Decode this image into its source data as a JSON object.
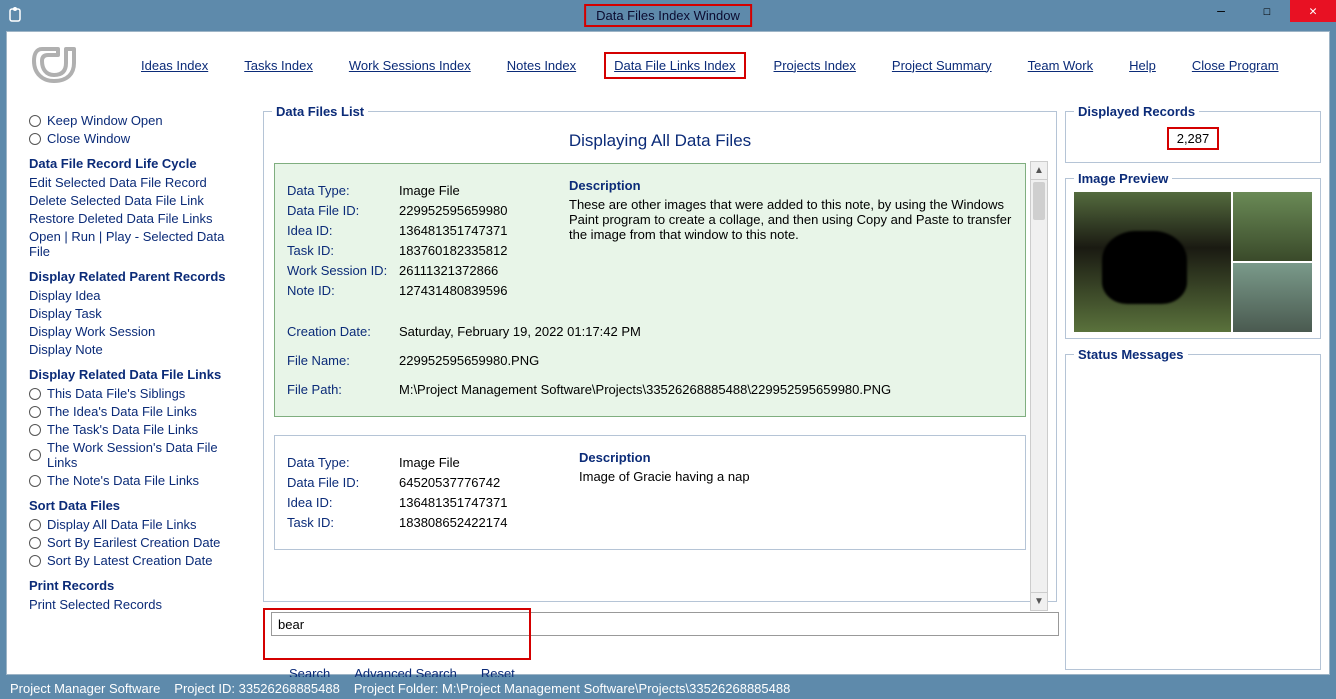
{
  "title": "Data Files Index Window",
  "menu": {
    "ideas": "Ideas Index",
    "tasks": "Tasks Index",
    "work": "Work Sessions Index",
    "notes": "Notes Index",
    "links": "Data File Links Index",
    "projects": "Projects Index",
    "summary": "Project Summary",
    "team": "Team Work",
    "help": "Help",
    "close": "Close Program"
  },
  "left": {
    "keep": "Keep Window Open",
    "closew": "Close Window",
    "h1": "Data File Record Life Cycle",
    "edit": "Edit Selected Data File Record",
    "del": "Delete Selected Data File Link",
    "restore": "Restore Deleted Data File Links",
    "open": "Open | Run | Play - Selected Data File",
    "h2": "Display Related Parent Records",
    "di": "Display Idea",
    "dt": "Display Task",
    "dw": "Display Work Session",
    "dn": "Display Note",
    "h3": "Display Related Data File Links",
    "r1": "This Data File's Siblings",
    "r2": "The Idea's Data File Links",
    "r3": "The Task's Data File Links",
    "r4": "The Work Session's Data File Links",
    "r5": "The Note's Data File Links",
    "h4": "Sort Data Files",
    "s1": "Display All Data File Links",
    "s2": "Sort By Earilest Creation Date",
    "s3": "Sort By Latest Creation Date",
    "h5": "Print Records",
    "p1": "Print Selected Records"
  },
  "list": {
    "legend": "Data Files List",
    "title": "Displaying All Data Files"
  },
  "labels": {
    "dtype": "Data Type:",
    "dfid": "Data File ID:",
    "iid": "Idea ID:",
    "tid": "Task ID:",
    "wsid": "Work Session ID:",
    "nid": "Note ID:",
    "cdate": "Creation Date:",
    "fname": "File Name:",
    "fpath": "File Path:",
    "desc": "Description"
  },
  "rec1": {
    "dtype": "Image File",
    "dfid": "229952595659980",
    "iid": "136481351747371",
    "tid": "183760182335812",
    "wsid": "26111321372866",
    "nid": "127431480839596",
    "cdate": "Saturday, February 19, 2022   01:17:42 PM",
    "fname": "229952595659980.PNG",
    "fpath": "M:\\Project Management Software\\Projects\\33526268885488\\229952595659980.PNG",
    "desc": "These are other images that were added to this note, by using the Windows Paint program to create a collage, and then using Copy and Paste to transfer the image from that window to this note."
  },
  "rec2": {
    "dtype": "Image File",
    "dfid": "64520537776742",
    "iid": "136481351747371",
    "tid": "183808652422174",
    "desc": "Image of Gracie having a nap"
  },
  "search": {
    "value": "bear",
    "search": "Search",
    "adv": "Advanced Search",
    "reset": "Reset"
  },
  "right": {
    "disp_legend": "Displayed Records",
    "count": "2,287",
    "prev_legend": "Image Preview",
    "status_legend": "Status Messages"
  },
  "status": {
    "app": "Project Manager Software",
    "pid_l": "Project ID:",
    "pid": "33526268885488",
    "pf_l": "Project Folder:",
    "pf": "M:\\Project Management Software\\Projects\\33526268885488"
  }
}
